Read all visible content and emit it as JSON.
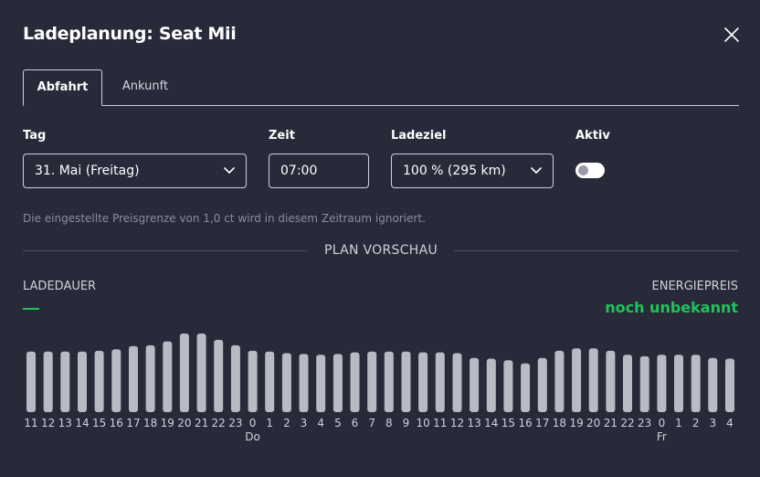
{
  "dialog": {
    "title": "Ladeplanung: Seat Mii"
  },
  "tabs": [
    {
      "label": "Abfahrt",
      "active": true
    },
    {
      "label": "Ankunft",
      "active": false
    }
  ],
  "form": {
    "day_label": "Tag",
    "day_value": "31. Mai (Freitag)",
    "time_label": "Zeit",
    "time_value": "07:00",
    "target_label": "Ladeziel",
    "target_value": "100 % (295 km)",
    "active_label": "Aktiv",
    "active_value": false
  },
  "hint": "Die eingestellte Preisgrenze von 1,0 ct wird in diesem Zeitraum ignoriert.",
  "preview": {
    "heading": "PLAN VORSCHAU",
    "duration_label": "LADEDAUER",
    "duration_value": "—",
    "price_label": "ENERGIEPREIS",
    "price_value": "noch unbekannt"
  },
  "colors": {
    "background": "#282a3a",
    "accent_green": "#1fc35a",
    "bar": "#b9bac4"
  },
  "chart_data": {
    "type": "bar",
    "categories": [
      "11",
      "12",
      "13",
      "14",
      "15",
      "16",
      "17",
      "18",
      "19",
      "20",
      "21",
      "22",
      "23",
      "0",
      "1",
      "2",
      "3",
      "4",
      "5",
      "6",
      "7",
      "8",
      "9",
      "10",
      "11",
      "12",
      "13",
      "14",
      "15",
      "16",
      "17",
      "18",
      "19",
      "20",
      "21",
      "22",
      "23",
      "0",
      "1",
      "2",
      "3",
      "4"
    ],
    "day_labels": [
      {
        "index": 13,
        "label": "Do"
      },
      {
        "index": 37,
        "label": "Fr"
      }
    ],
    "values": [
      0.77,
      0.77,
      0.77,
      0.77,
      0.78,
      0.8,
      0.84,
      0.85,
      0.9,
      1.0,
      1.0,
      0.92,
      0.85,
      0.78,
      0.77,
      0.75,
      0.74,
      0.73,
      0.74,
      0.76,
      0.77,
      0.77,
      0.77,
      0.76,
      0.76,
      0.75,
      0.69,
      0.68,
      0.66,
      0.62,
      0.69,
      0.78,
      0.81,
      0.81,
      0.78,
      0.73,
      0.71,
      0.73,
      0.73,
      0.73,
      0.69,
      0.68
    ]
  }
}
